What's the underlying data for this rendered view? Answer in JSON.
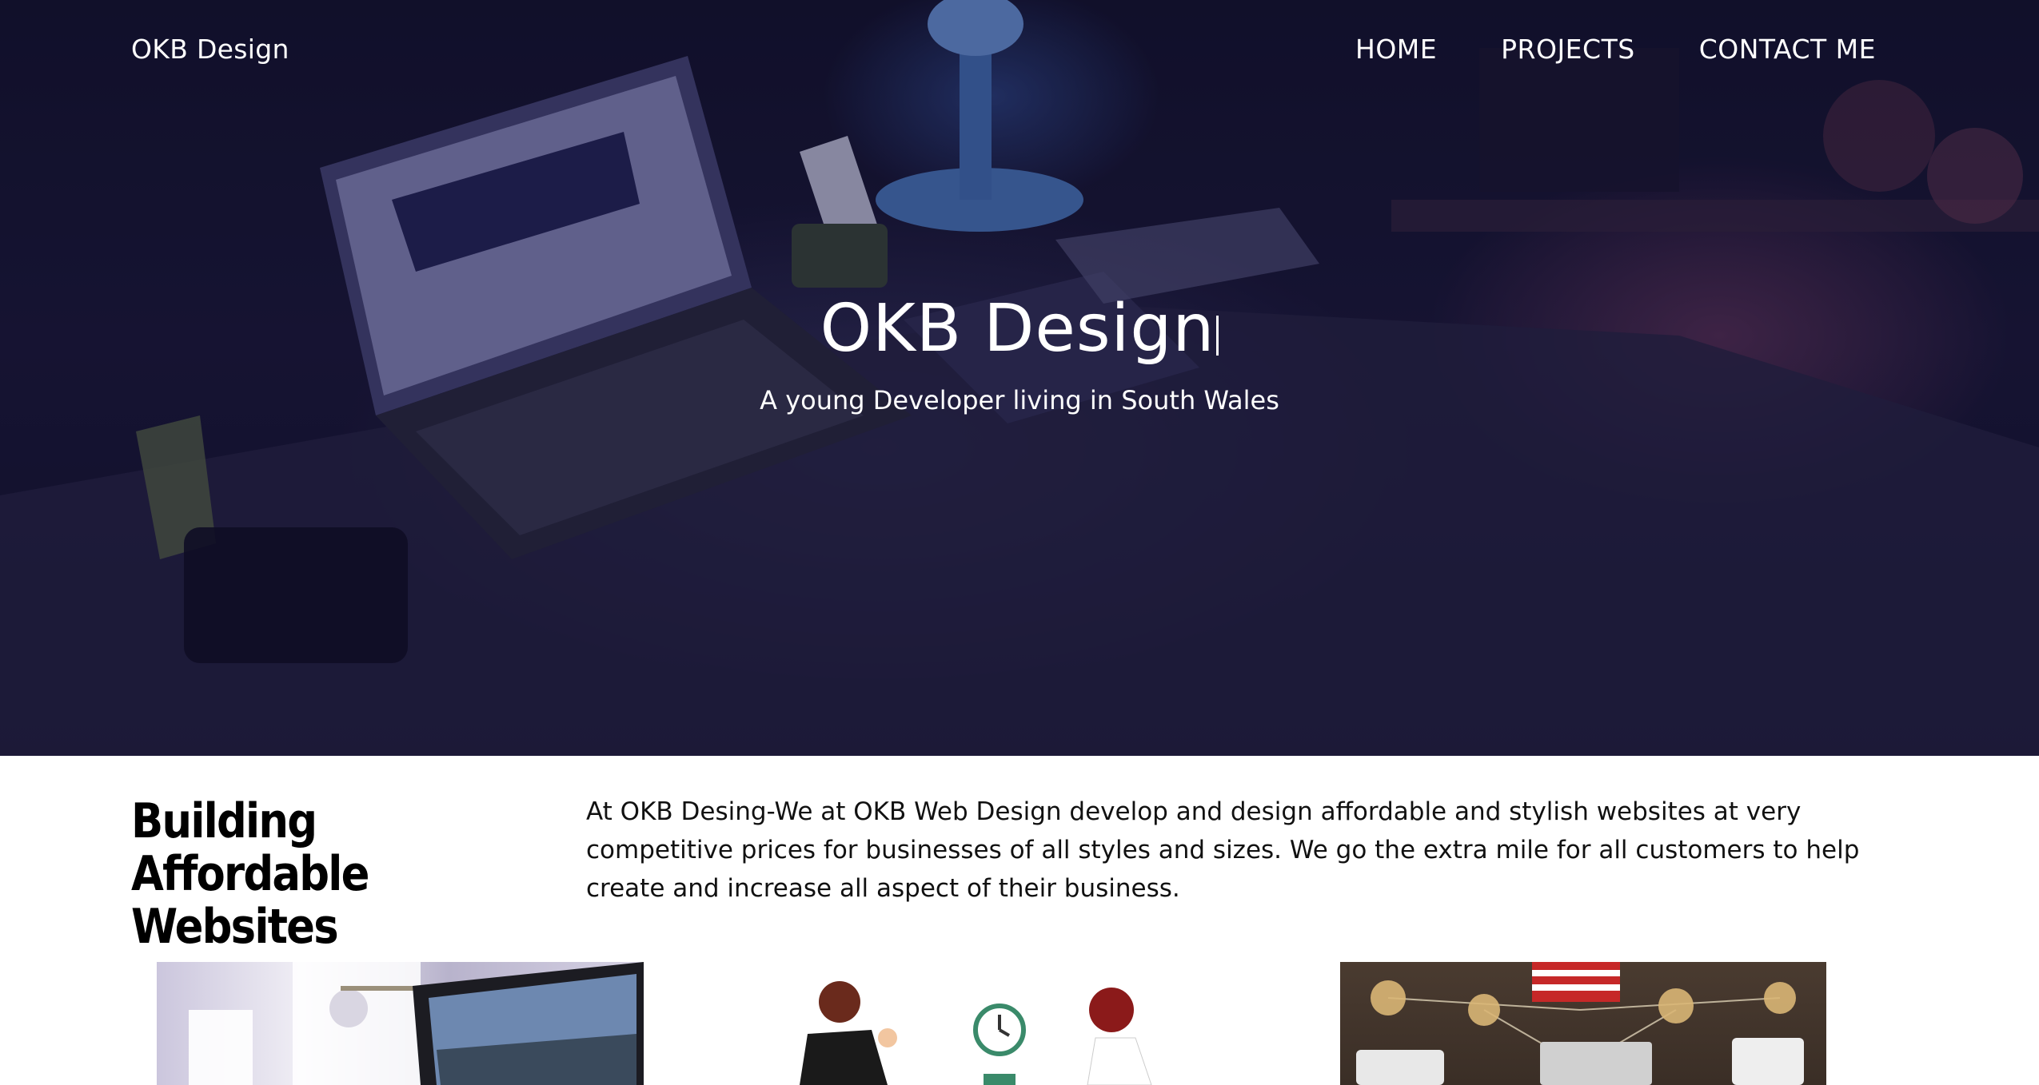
{
  "nav": {
    "brand": "OKB Design",
    "links": [
      "HOME",
      "PROJECTS",
      "CONTACT ME"
    ]
  },
  "hero": {
    "title": "OKB Design",
    "subtitle": "A young Developer living in South Wales"
  },
  "about": {
    "heading": "Building Affordable Websites",
    "text": "At OKB Desing-We at OKB Web Design develop and design affordable and stylish websites at very competitive prices for businesses of all styles and sizes. We go the extra mile for all customers to help create and increase all aspect of their business."
  },
  "cards": [
    {
      "image": "workspace-laptop-photo"
    },
    {
      "image": "business-meeting-illustration"
    },
    {
      "image": "team-devices-network-photo"
    }
  ],
  "colors": {
    "hero_overlay": "#1a1838",
    "text_on_hero": "#ffffff",
    "body_text": "#000000"
  }
}
